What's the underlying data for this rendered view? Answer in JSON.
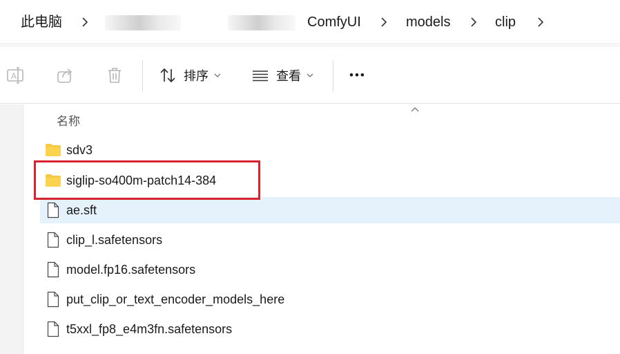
{
  "breadcrumb": {
    "root": "此电脑",
    "folders": [
      "ComfyUI",
      "models",
      "clip"
    ]
  },
  "toolbar": {
    "sort_label": "排序",
    "view_label": "查看",
    "more_label": "•••"
  },
  "file_list": {
    "column_name": "名称",
    "items": [
      {
        "name": "sdv3",
        "type": "folder"
      },
      {
        "name": "siglip-so400m-patch14-384",
        "type": "folder"
      },
      {
        "name": "ae.sft",
        "type": "file"
      },
      {
        "name": "clip_l.safetensors",
        "type": "file"
      },
      {
        "name": "model.fp16.safetensors",
        "type": "file"
      },
      {
        "name": "put_clip_or_text_encoder_models_here",
        "type": "file"
      },
      {
        "name": "t5xxl_fp8_e4m3fn.safetensors",
        "type": "file"
      }
    ]
  },
  "colors": {
    "selection": "#e5f1fb",
    "highlight": "#d9242f",
    "folder": "#f8c847"
  }
}
